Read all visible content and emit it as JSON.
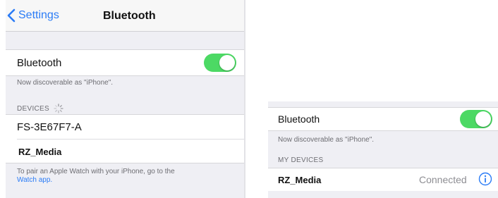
{
  "left": {
    "nav": {
      "back_label": "Settings",
      "title": "Bluetooth"
    },
    "bluetooth_row": {
      "label": "Bluetooth",
      "enabled": true
    },
    "discoverable_text": "Now discoverable as \"iPhone\".",
    "devices_header": "DEVICES",
    "devices": [
      {
        "name": "FS-3E67F7-A"
      },
      {
        "name": "RZ_Media"
      }
    ],
    "footer": {
      "text": "To pair an Apple Watch with your iPhone, go to the",
      "link": "Watch app."
    }
  },
  "right": {
    "bluetooth_row": {
      "label": "Bluetooth",
      "enabled": true
    },
    "discoverable_text": "Now discoverable as \"iPhone\".",
    "devices_header": "MY DEVICES",
    "devices": [
      {
        "name": "RZ_Media",
        "status": "Connected"
      }
    ]
  },
  "colors": {
    "accent": "#2b7cf6",
    "toggle_on": "#4cd964",
    "group_bg": "#efeff4"
  },
  "icons": [
    "chevron-left-icon",
    "spinner-icon",
    "info-icon"
  ]
}
